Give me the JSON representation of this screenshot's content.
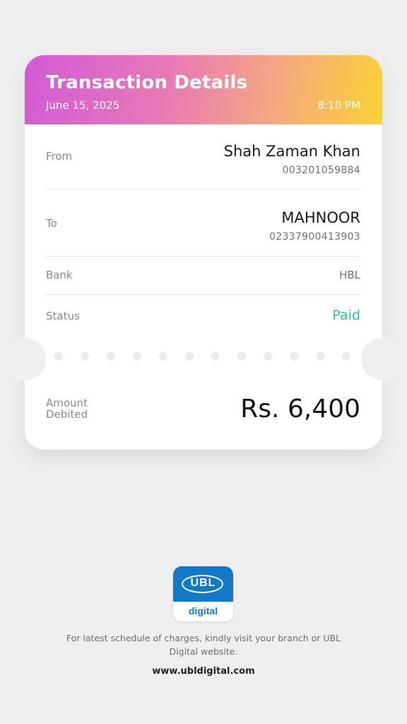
{
  "header": {
    "title": "Transaction Details",
    "date": "June 15, 2025",
    "time": "8:10 PM"
  },
  "from": {
    "label": "From",
    "name": "Shah Zaman Khan",
    "account": "003201059884"
  },
  "to": {
    "label": "To",
    "name": "MAHNOOR",
    "account": "02337900413903"
  },
  "bank": {
    "label": "Bank",
    "value": "HBL"
  },
  "status": {
    "label": "Status",
    "value": "Paid",
    "color": "#28c79a"
  },
  "amount": {
    "label": "Amount Debited",
    "value": "Rs. 6,400"
  },
  "logo": {
    "text": "UBL",
    "subtext": "digital",
    "brand_color": "#1278c8"
  },
  "footer": {
    "note": "For latest schedule of charges, kindly visit your branch or UBL Digital website.",
    "website": "www.ubldigital.com"
  },
  "colors": {
    "gradient_start": "#d35ad6",
    "gradient_end": "#fbd233",
    "background": "#efefef"
  }
}
